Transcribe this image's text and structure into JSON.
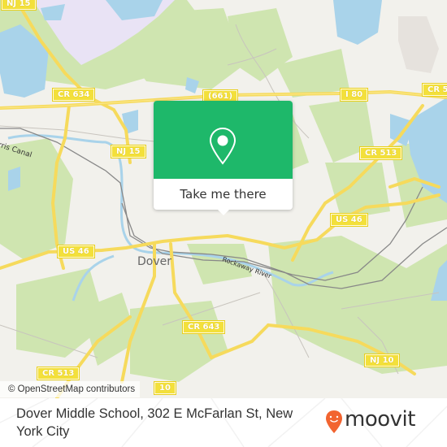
{
  "map": {
    "attribution": "© OpenStreetMap contributors",
    "road_labels": [
      {
        "id": "nj15-top",
        "text": "NJ 15"
      },
      {
        "id": "cr634",
        "text": "CR 634"
      },
      {
        "id": "cr661",
        "text": "(661)"
      },
      {
        "id": "i80",
        "text": "I 80"
      },
      {
        "id": "cr513-right",
        "text": "CR 513"
      },
      {
        "id": "nj15-mid",
        "text": "NJ 15"
      },
      {
        "id": "us46-right",
        "text": "US 46"
      },
      {
        "id": "us46-left",
        "text": "US 46"
      },
      {
        "id": "cr643",
        "text": "CR 643"
      },
      {
        "id": "nj10",
        "text": "NJ 10"
      },
      {
        "id": "cr513-bottom",
        "text": "CR 513"
      },
      {
        "id": "nj10-bottom",
        "text": "10"
      }
    ],
    "place_labels": {
      "town": "Dover",
      "canal": "Morris Canal",
      "river": "Rockaway River"
    }
  },
  "popup": {
    "icon": "location-pin-icon",
    "button_label": "Take me there",
    "accent_color": "#1eb86a"
  },
  "footer": {
    "address": "Dover Middle School, 302 E McFarlan St, New York City",
    "brand": "moovit",
    "brand_color": "#f26430"
  }
}
